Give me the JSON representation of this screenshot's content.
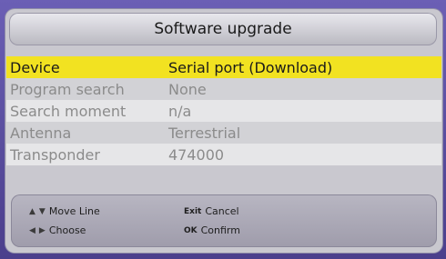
{
  "title": "Software upgrade",
  "rows": [
    {
      "label": "Device",
      "value": "Serial port (Download)",
      "selected": true
    },
    {
      "label": "Program search",
      "value": "None",
      "selected": false
    },
    {
      "label": "Search moment",
      "value": "n/a",
      "selected": false
    },
    {
      "label": "Antenna",
      "value": "Terrestrial",
      "selected": false
    },
    {
      "label": "Transponder",
      "value": "474000",
      "selected": false
    }
  ],
  "help": {
    "move_line": "Move Line",
    "choose": "Choose",
    "exit_key": "Exit",
    "cancel": "Cancel",
    "ok_key": "OK",
    "confirm": "Confirm"
  },
  "colors": {
    "highlight": "#f2e221",
    "background": "#5a4fa0"
  }
}
